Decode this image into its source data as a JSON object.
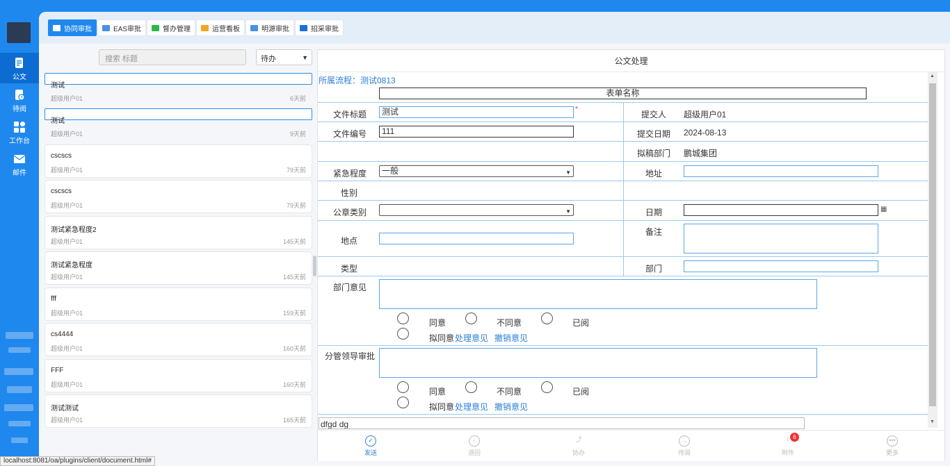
{
  "rail": {
    "items": [
      {
        "label": "公文",
        "icon": "document-icon"
      },
      {
        "label": "待阅",
        "icon": "pending-read-icon"
      },
      {
        "label": "工作台",
        "icon": "grid-icon"
      },
      {
        "label": "邮件",
        "icon": "mail-icon"
      }
    ]
  },
  "toolbar": {
    "tabs": [
      {
        "label": "协同审批",
        "icon": "folder-icon",
        "color": "#ffffff"
      },
      {
        "label": "EAS审批",
        "icon": "server-icon",
        "color": "#4a90e2"
      },
      {
        "label": "督办管理",
        "icon": "supervise-icon",
        "color": "#2db84d"
      },
      {
        "label": "运营看板",
        "icon": "briefcase-icon",
        "color": "#f5a623"
      },
      {
        "label": "明源审批",
        "icon": "monitor-icon",
        "color": "#4a90e2"
      },
      {
        "label": "招采审批",
        "icon": "folder-icon",
        "color": "#1e6fd9"
      }
    ]
  },
  "list": {
    "search_placeholder": "搜索 标题",
    "filter_value": "待办",
    "items": [
      {
        "title": "测试",
        "user": "超级用户01",
        "age": "6天前"
      },
      {
        "title": "测试",
        "user": "超级用户01",
        "age": "9天前"
      },
      {
        "title": "cscscs",
        "user": "超级用户01",
        "age": "79天前"
      },
      {
        "title": "cscscs",
        "user": "超级用户01",
        "age": "79天前"
      },
      {
        "title": "测试紧急程度2",
        "user": "超级用户01",
        "age": "145天前"
      },
      {
        "title": "测试紧急程度",
        "user": "超级用户01",
        "age": "145天前"
      },
      {
        "title": "fff",
        "user": "超级用户01",
        "age": "159天前"
      },
      {
        "title": "cs4444",
        "user": "超级用户01",
        "age": "160天前"
      },
      {
        "title": "FFF",
        "user": "超级用户01",
        "age": "160天前"
      },
      {
        "title": "测试测试",
        "user": "超级用户01",
        "age": "165天前"
      }
    ]
  },
  "form": {
    "header": "公文处理",
    "flow": "所属流程：测试0813",
    "form_name": "表单名称",
    "labels": {
      "title": "文件标题",
      "number": "文件编号",
      "urgency": "紧急程度",
      "gender": "性别",
      "seal_type": "公章类别",
      "location": "地点",
      "type": "类型",
      "dept_opinion": "部门意见",
      "leader_approval": "分管领导审批",
      "submitter": "提交人",
      "submit_date": "提交日期",
      "draft_dept": "拟稿部门",
      "address": "地址",
      "date": "日期",
      "remark": "备注",
      "department": "部门"
    },
    "values": {
      "title": "测试",
      "number": "111",
      "urgency": "一般",
      "seal_type": "",
      "submitter": "超级用户01",
      "submit_date": "2024-08-13",
      "draft_dept": "鹏城集团",
      "bottom_note": "dfgd dg"
    },
    "opinion_options": {
      "agree": "同意",
      "disagree": "不同意",
      "read": "已阅",
      "proposed": "拟同意",
      "handle": "处理意见",
      "revoke": "撤销意见"
    }
  },
  "actions": {
    "send": "发送",
    "return": "退回",
    "assist": "协办",
    "circulate": "传阅",
    "attachment": "附件",
    "attachment_count": "6",
    "more": "更多"
  },
  "statusbar": "localhost:8081/oa/plugins/client/document.html#"
}
